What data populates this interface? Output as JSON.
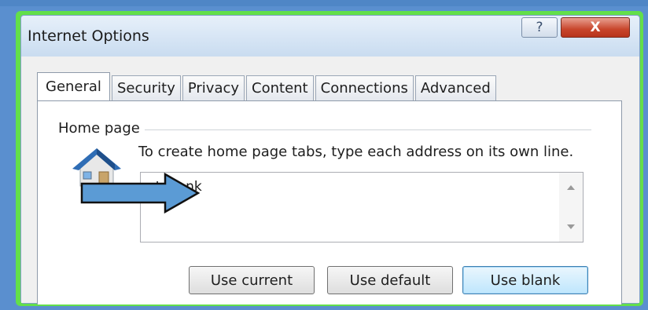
{
  "window": {
    "title": "Internet Options",
    "help_label": "?",
    "close_label": "X"
  },
  "tabs": [
    {
      "label": "General",
      "active": true
    },
    {
      "label": "Security",
      "active": false
    },
    {
      "label": "Privacy",
      "active": false
    },
    {
      "label": "Content",
      "active": false
    },
    {
      "label": "Connections",
      "active": false
    },
    {
      "label": "Advanced",
      "active": false
    }
  ],
  "home_page": {
    "group_label": "Home page",
    "instruction": "To create home page tabs, type each address on its own line.",
    "address_value": "ut:blank",
    "buttons": {
      "use_current": "Use current",
      "use_default": "Use default",
      "use_blank": "Use blank"
    }
  },
  "colors": {
    "highlight_frame": "#63df4a",
    "background_blue": "#5a8fcf",
    "arrow_fill": "#5b9bd5",
    "close_red": "#c8452b"
  },
  "icons": {
    "house": "house-icon",
    "arrow": "arrow-right-icon"
  }
}
